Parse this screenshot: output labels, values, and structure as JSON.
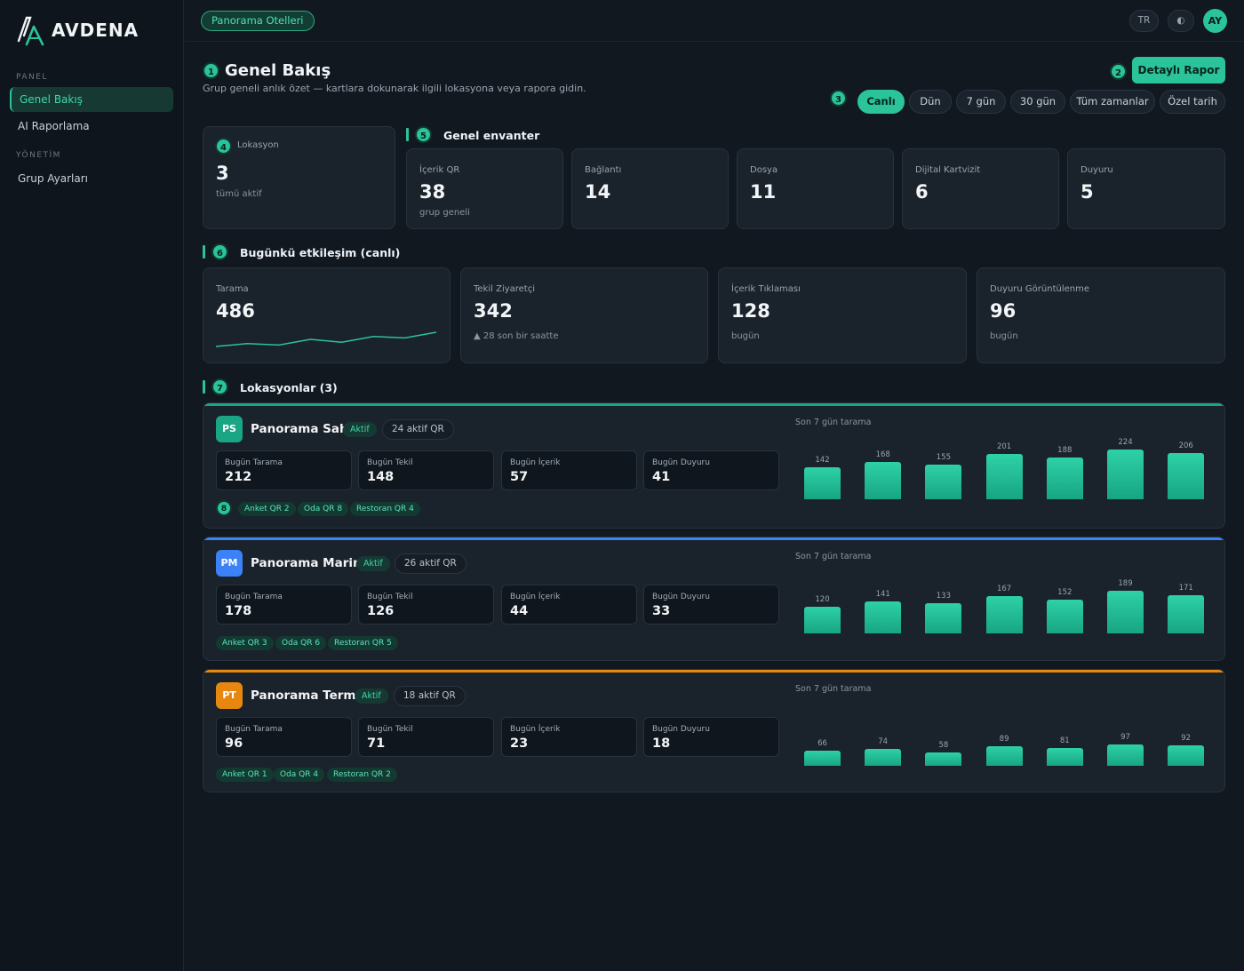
{
  "brand": {
    "name": "AVDENA",
    "logo_letter": "A"
  },
  "sidebar": {
    "sections": [
      {
        "label": "PANEL",
        "items": [
          {
            "label": "Genel Bakış",
            "active": true
          },
          {
            "label": "AI Raporlama",
            "active": false
          }
        ]
      },
      {
        "label": "YÖNETİM",
        "items": [
          {
            "label": "Grup Ayarları",
            "active": false
          }
        ]
      }
    ]
  },
  "topbar": {
    "hotel": "Panorama Otelleri",
    "lang": "TR",
    "theme_icon": "◐",
    "avatar": "AY"
  },
  "header": {
    "badge": "1",
    "title": "Genel Bakış",
    "subtitle": "Grup geneli anlık özet — kartlara dokunarak ilgili lokasyona veya rapora gidin.",
    "report_badge": "2",
    "report_button": "Detaylı Rapor",
    "range_badge": "3",
    "ranges": [
      {
        "label": "Canlı",
        "active": true
      },
      {
        "label": "Dün",
        "active": false
      },
      {
        "label": "7 gün",
        "active": false
      },
      {
        "label": "30 gün",
        "active": false
      },
      {
        "label": "Tüm zamanlar",
        "active": false
      },
      {
        "label": "Özel tarih",
        "active": false
      }
    ]
  },
  "location_card": {
    "badge": "4",
    "label": "Lokasyon",
    "value": "3",
    "sub": "tümü aktif"
  },
  "inventory": {
    "badge": "5",
    "title": "Genel envanter",
    "cards": [
      {
        "label": "İçerik QR",
        "value": "38",
        "sub": "grup geneli"
      },
      {
        "label": "Bağlantı",
        "value": "14",
        "sub": ""
      },
      {
        "label": "Dosya",
        "value": "11",
        "sub": ""
      },
      {
        "label": "Dijital Kartvizit",
        "value": "6",
        "sub": ""
      },
      {
        "label": "Duyuru",
        "value": "5",
        "sub": ""
      }
    ]
  },
  "engagement": {
    "badge": "6",
    "title": "Bugünkü etkileşim (canlı)",
    "cards": [
      {
        "label": "Tarama",
        "value": "486",
        "sub": ""
      },
      {
        "label": "Tekil Ziyaretçi",
        "value": "342",
        "sub": "▲ 28 son bir saatte"
      },
      {
        "label": "İçerik Tıklaması",
        "value": "128",
        "sub": "bugün"
      },
      {
        "label": "Duyuru Görüntülenme",
        "value": "96",
        "sub": "bugün"
      }
    ],
    "sparkline": [
      4,
      6,
      5,
      9,
      7,
      11,
      10,
      14
    ]
  },
  "locations": {
    "badge": "7",
    "title": "Lokasyonlar (3)",
    "tag_badge": "8",
    "chart_title": "Son 7 gün tarama",
    "items": [
      {
        "initials": "PS",
        "color": "#1aa584",
        "name": "Panorama Sahil",
        "status": "Aktif",
        "qr": "24 aktif QR",
        "stats": [
          {
            "label": "Bugün Tarama",
            "value": "212"
          },
          {
            "label": "Bugün Tekil",
            "value": "148"
          },
          {
            "label": "Bugün İçerik",
            "value": "57"
          },
          {
            "label": "Bugün Duyuru",
            "value": "41"
          }
        ],
        "tags": [
          "Anket QR 2",
          "Oda QR 8",
          "Restoran QR 4"
        ],
        "chart": [
          142,
          168,
          155,
          201,
          188,
          224,
          206
        ]
      },
      {
        "initials": "PM",
        "color": "#3b82f6",
        "name": "Panorama Marina",
        "status": "Aktif",
        "qr": "26 aktif QR",
        "stats": [
          {
            "label": "Bugün Tarama",
            "value": "178"
          },
          {
            "label": "Bugün Tekil",
            "value": "126"
          },
          {
            "label": "Bugün İçerik",
            "value": "44"
          },
          {
            "label": "Bugün Duyuru",
            "value": "33"
          }
        ],
        "tags": [
          "Anket QR 3",
          "Oda QR 6",
          "Restoran QR 5"
        ],
        "chart": [
          120,
          141,
          133,
          167,
          152,
          189,
          171
        ]
      },
      {
        "initials": "PT",
        "color": "#e8870f",
        "name": "Panorama Termal",
        "status": "Aktif",
        "qr": "18 aktif QR",
        "stats": [
          {
            "label": "Bugün Tarama",
            "value": "96"
          },
          {
            "label": "Bugün Tekil",
            "value": "71"
          },
          {
            "label": "Bugün İçerik",
            "value": "23"
          },
          {
            "label": "Bugün Duyuru",
            "value": "18"
          }
        ],
        "tags": [
          "Anket QR 1",
          "Oda QR 4",
          "Restoran QR 2"
        ],
        "chart": [
          66,
          74,
          58,
          89,
          81,
          97,
          92
        ]
      }
    ]
  }
}
